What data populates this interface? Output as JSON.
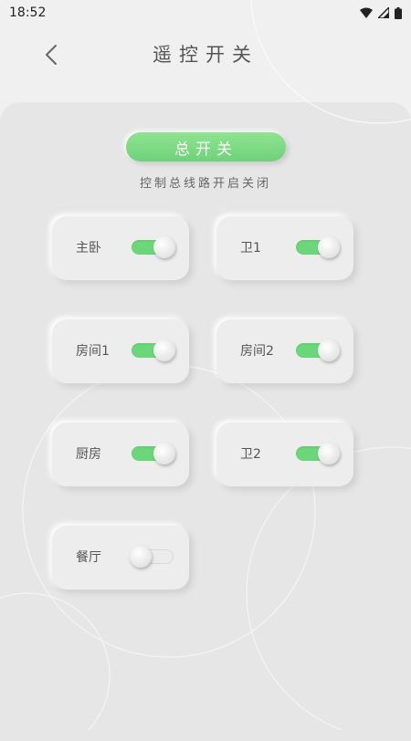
{
  "status_bar": {
    "time": "18:52"
  },
  "header": {
    "title": "遥控开关",
    "back_icon": "chevron-left-icon"
  },
  "master": {
    "label": "总开关",
    "description": "控制总线路开启关闭",
    "accent": "#6fd17a"
  },
  "switches": [
    {
      "label": "主卧",
      "on": true
    },
    {
      "label": "卫1",
      "on": true
    },
    {
      "label": "房间1",
      "on": true
    },
    {
      "label": "房间2",
      "on": true
    },
    {
      "label": "厨房",
      "on": true
    },
    {
      "label": "卫2",
      "on": true
    },
    {
      "label": "餐厅",
      "on": false
    }
  ]
}
